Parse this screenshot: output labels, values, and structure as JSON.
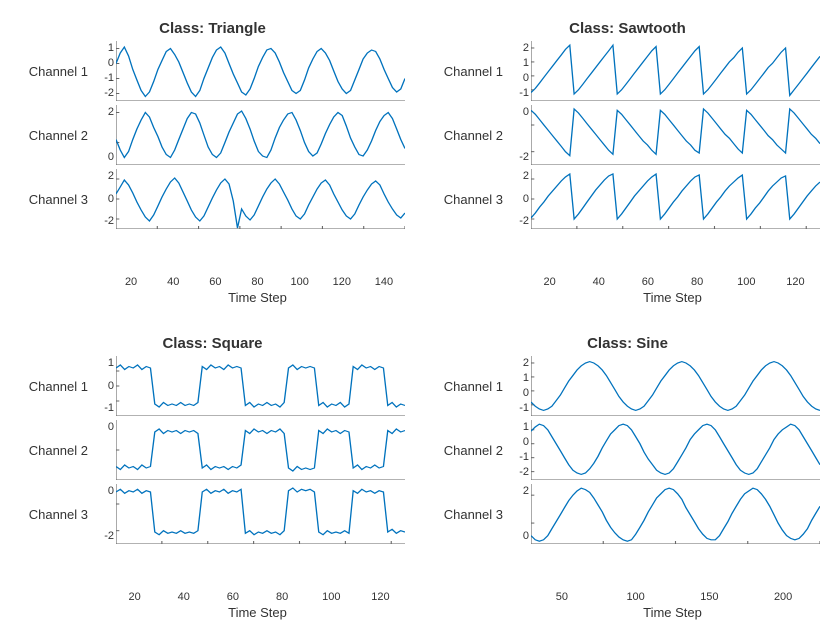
{
  "colors": {
    "line": "#0072BD",
    "axis": "#666"
  },
  "chart_data": [
    {
      "title": "Class: Triangle",
      "xlabel": "Time Step",
      "xlim": [
        0,
        140
      ],
      "xticks": [
        20,
        40,
        60,
        80,
        100,
        120,
        140
      ],
      "channels": [
        {
          "label": "Channel 1",
          "yticks": [
            1,
            0,
            -1,
            -2
          ],
          "ylim": [
            -2.5,
            1.5
          ],
          "values": [
            0.0,
            0.7,
            1.1,
            0.5,
            -0.4,
            -1.1,
            -1.8,
            -2.2,
            -1.9,
            -1.2,
            -0.4,
            0.2,
            0.8,
            1.0,
            0.6,
            0.1,
            -0.6,
            -1.3,
            -1.9,
            -2.2,
            -1.8,
            -1.0,
            -0.3,
            0.4,
            0.9,
            1.1,
            0.7,
            0.0,
            -0.7,
            -1.3,
            -1.9,
            -2.1,
            -1.7,
            -1.0,
            -0.2,
            0.4,
            0.9,
            1.0,
            0.7,
            0.1,
            -0.6,
            -1.2,
            -1.8,
            -2.0,
            -1.8,
            -1.1,
            -0.3,
            0.3,
            0.8,
            1.0,
            0.7,
            0.2,
            -0.5,
            -1.2,
            -1.7,
            -2.0,
            -1.8,
            -1.1,
            -0.4,
            0.3,
            0.7,
            0.9,
            0.8,
            0.3,
            -0.4,
            -1.0,
            -1.6,
            -1.9,
            -1.7,
            -1.0
          ]
        },
        {
          "label": "Channel 2",
          "yticks": [
            2,
            0
          ],
          "ylim": [
            -1.5,
            2.5
          ],
          "values": [
            0.2,
            -0.5,
            -1.0,
            -0.6,
            0.2,
            0.9,
            1.5,
            2.0,
            1.7,
            1.0,
            0.4,
            -0.3,
            -0.8,
            -1.0,
            -0.5,
            0.2,
            0.9,
            1.6,
            2.0,
            1.9,
            1.3,
            0.5,
            -0.3,
            -0.8,
            -1.0,
            -0.7,
            0.0,
            0.7,
            1.3,
            1.9,
            2.1,
            1.6,
            0.9,
            0.1,
            -0.6,
            -0.9,
            -1.0,
            -0.5,
            0.3,
            1.0,
            1.5,
            1.9,
            2.0,
            1.5,
            0.8,
            0.0,
            -0.6,
            -0.9,
            -0.7,
            -0.1,
            0.6,
            1.2,
            1.7,
            2.0,
            1.8,
            1.1,
            0.3,
            -0.3,
            -0.8,
            -0.9,
            -0.5,
            0.1,
            0.8,
            1.4,
            1.8,
            2.0,
            1.6,
            0.9,
            0.2,
            -0.4
          ]
        },
        {
          "label": "Channel 3",
          "yticks": [
            2,
            0,
            -2
          ],
          "ylim": [
            -3,
            3
          ],
          "values": [
            0.5,
            1.2,
            1.9,
            1.4,
            0.6,
            -0.3,
            -1.1,
            -1.8,
            -2.2,
            -1.6,
            -0.7,
            0.2,
            1.0,
            1.7,
            2.1,
            1.6,
            0.7,
            -0.2,
            -1.1,
            -1.8,
            -2.2,
            -1.7,
            -0.8,
            0.1,
            0.9,
            1.6,
            2.0,
            1.5,
            -0.2,
            -2.9,
            -1.0,
            -1.7,
            -2.1,
            -1.6,
            -0.7,
            0.2,
            1.0,
            1.6,
            2.0,
            1.5,
            0.7,
            -0.1,
            -1.0,
            -1.7,
            -2.0,
            -1.5,
            -0.6,
            0.2,
            1.0,
            1.6,
            1.9,
            1.4,
            0.5,
            -0.3,
            -1.1,
            -1.7,
            -2.0,
            -1.5,
            -0.6,
            0.2,
            0.9,
            1.5,
            1.8,
            1.4,
            0.5,
            -0.3,
            -1.0,
            -1.6,
            -1.9,
            -1.4
          ]
        }
      ]
    },
    {
      "title": "Class: Sawtooth",
      "xlabel": "Time Step",
      "xlim": [
        0,
        126
      ],
      "xticks": [
        20,
        40,
        60,
        80,
        100,
        120
      ],
      "channels": [
        {
          "label": "Channel 1",
          "yticks": [
            2,
            1,
            0,
            -1
          ],
          "ylim": [
            -1.8,
            2.5
          ],
          "values": [
            -1.2,
            -0.9,
            -0.5,
            -0.1,
            0.3,
            0.7,
            1.1,
            1.5,
            1.9,
            2.2,
            -1.3,
            -1.0,
            -0.6,
            -0.2,
            0.2,
            0.6,
            1.0,
            1.4,
            1.8,
            2.2,
            -1.3,
            -1.0,
            -0.6,
            -0.2,
            0.2,
            0.6,
            1.0,
            1.4,
            1.8,
            2.1,
            -1.3,
            -1.0,
            -0.6,
            -0.2,
            0.2,
            0.6,
            1.0,
            1.4,
            1.8,
            2.1,
            -1.3,
            -1.0,
            -0.6,
            -0.2,
            0.2,
            0.6,
            1.0,
            1.3,
            1.7,
            2.0,
            -1.3,
            -1.0,
            -0.6,
            -0.2,
            0.2,
            0.6,
            0.9,
            1.3,
            1.7,
            2.0,
            -1.4,
            -1.0,
            -0.6,
            -0.2,
            0.2,
            0.6,
            1.0,
            1.4
          ]
        },
        {
          "label": "Channel 2",
          "yticks": [
            0,
            -2
          ],
          "ylim": [
            -3,
            1.5
          ],
          "values": [
            1.1,
            0.8,
            0.4,
            0.0,
            -0.4,
            -0.8,
            -1.2,
            -1.6,
            -2.0,
            -2.3,
            1.2,
            0.9,
            0.5,
            0.1,
            -0.3,
            -0.7,
            -1.1,
            -1.5,
            -1.9,
            -2.2,
            1.1,
            0.8,
            0.4,
            0.0,
            -0.4,
            -0.8,
            -1.2,
            -1.5,
            -1.9,
            -2.2,
            1.1,
            0.8,
            0.4,
            0.0,
            -0.4,
            -0.8,
            -1.2,
            -1.5,
            -1.9,
            -2.1,
            1.2,
            0.9,
            0.5,
            0.1,
            -0.3,
            -0.7,
            -1.0,
            -1.4,
            -1.8,
            -2.1,
            1.1,
            0.8,
            0.4,
            0.0,
            -0.4,
            -0.8,
            -1.1,
            -1.5,
            -1.8,
            -2.1,
            1.2,
            0.9,
            0.5,
            0.1,
            -0.3,
            -0.7,
            -1.0,
            -1.4
          ]
        },
        {
          "label": "Channel 3",
          "yticks": [
            2,
            0,
            -2
          ],
          "ylim": [
            -3,
            3
          ],
          "values": [
            -1.9,
            -1.4,
            -0.8,
            -0.3,
            0.3,
            0.8,
            1.3,
            1.8,
            2.2,
            2.5,
            -2.0,
            -1.5,
            -0.9,
            -0.3,
            0.3,
            0.9,
            1.4,
            1.9,
            2.3,
            2.5,
            -2.0,
            -1.5,
            -0.9,
            -0.3,
            0.3,
            0.8,
            1.3,
            1.8,
            2.2,
            2.5,
            -2.0,
            -1.5,
            -0.9,
            -0.3,
            0.2,
            0.8,
            1.3,
            1.8,
            2.2,
            2.4,
            -2.0,
            -1.5,
            -0.9,
            -0.3,
            0.2,
            0.8,
            1.3,
            1.7,
            2.1,
            2.4,
            -2.0,
            -1.5,
            -0.9,
            -0.4,
            0.2,
            0.8,
            1.3,
            1.7,
            2.1,
            2.3,
            -2.0,
            -1.5,
            -0.9,
            -0.3,
            0.3,
            0.8,
            1.3,
            1.7
          ]
        }
      ]
    },
    {
      "title": "Class: Square",
      "xlabel": "Time Step",
      "xlim": [
        0,
        126
      ],
      "xticks": [
        20,
        40,
        60,
        80,
        100,
        120
      ],
      "channels": [
        {
          "label": "Channel 1",
          "yticks": [
            1,
            0,
            -1
          ],
          "ylim": [
            -2,
            2
          ],
          "values": [
            1.2,
            1.4,
            1.1,
            1.3,
            1.2,
            1.4,
            1.1,
            1.3,
            1.2,
            -1.2,
            -1.4,
            -1.1,
            -1.3,
            -1.2,
            -1.3,
            -1.1,
            -1.3,
            -1.2,
            -1.3,
            -1.1,
            1.3,
            1.1,
            1.4,
            1.2,
            1.3,
            1.1,
            1.4,
            1.2,
            1.3,
            1.2,
            -1.3,
            -1.1,
            -1.4,
            -1.2,
            -1.3,
            -1.1,
            -1.3,
            -1.2,
            -1.4,
            -1.1,
            1.2,
            1.4,
            1.1,
            1.3,
            1.2,
            1.3,
            1.2,
            -1.3,
            -1.1,
            -1.4,
            -1.2,
            -1.3,
            -1.1,
            -1.4,
            -1.2,
            1.3,
            1.1,
            1.4,
            1.2,
            1.3,
            1.1,
            1.3,
            1.2,
            -1.3,
            -1.1,
            -1.4,
            -1.2,
            -1.3
          ]
        },
        {
          "label": "Channel 2",
          "yticks": [
            0
          ],
          "ylim": [
            -2,
            2
          ],
          "values": [
            -1.1,
            -1.3,
            -1.0,
            -1.2,
            -1.1,
            -1.3,
            -1.0,
            -1.2,
            -1.1,
            1.2,
            1.4,
            1.1,
            1.3,
            1.2,
            1.3,
            1.1,
            1.3,
            1.2,
            1.3,
            1.1,
            -1.2,
            -1.0,
            -1.3,
            -1.1,
            -1.2,
            -1.1,
            -1.3,
            -1.1,
            -1.2,
            -1.0,
            1.3,
            1.1,
            1.4,
            1.2,
            1.3,
            1.1,
            1.3,
            1.2,
            1.4,
            1.1,
            -1.2,
            -1.4,
            -1.1,
            -1.3,
            -1.2,
            -1.3,
            -1.2,
            1.3,
            1.1,
            1.4,
            1.2,
            1.3,
            1.1,
            1.3,
            1.2,
            -1.2,
            -1.0,
            -1.3,
            -1.1,
            -1.2,
            -1.0,
            -1.2,
            -1.1,
            1.3,
            1.1,
            1.4,
            1.2,
            1.3
          ]
        },
        {
          "label": "Channel 3",
          "yticks": [
            0,
            -2
          ],
          "ylim": [
            -3,
            1.5
          ],
          "values": [
            0.9,
            1.1,
            0.8,
            1.0,
            0.9,
            1.1,
            0.8,
            1.0,
            0.9,
            -2.1,
            -2.3,
            -2.0,
            -2.2,
            -2.1,
            -2.2,
            -2.0,
            -2.2,
            -2.1,
            -2.2,
            -2.0,
            0.9,
            1.1,
            0.8,
            1.0,
            0.9,
            1.1,
            0.8,
            1.0,
            0.9,
            1.1,
            -2.2,
            -2.0,
            -2.3,
            -2.1,
            -2.2,
            -2.0,
            -2.2,
            -2.1,
            -2.3,
            -2.0,
            1.0,
            1.2,
            0.9,
            1.1,
            1.0,
            1.1,
            0.9,
            -2.1,
            -2.3,
            -2.0,
            -2.2,
            -2.1,
            -2.2,
            -2.0,
            -2.2,
            1.0,
            0.8,
            1.1,
            0.9,
            1.0,
            0.8,
            1.0,
            0.9,
            -2.1,
            -1.9,
            -2.2,
            -2.0,
            -2.1
          ]
        }
      ]
    },
    {
      "title": "Class: Sine",
      "xlabel": "Time Step",
      "xlim": [
        0,
        200
      ],
      "xticks": [
        50,
        100,
        150,
        200
      ],
      "channels": [
        {
          "label": "Channel 1",
          "yticks": [
            2,
            1,
            0,
            -1
          ],
          "ylim": [
            -1.8,
            2.5
          ],
          "values": [
            -0.8,
            -1.1,
            -1.3,
            -1.4,
            -1.3,
            -1.1,
            -0.7,
            -0.3,
            0.2,
            0.7,
            1.1,
            1.5,
            1.8,
            2.0,
            2.1,
            2.0,
            1.8,
            1.5,
            1.1,
            0.6,
            0.1,
            -0.4,
            -0.8,
            -1.1,
            -1.3,
            -1.4,
            -1.3,
            -1.1,
            -0.7,
            -0.3,
            0.2,
            0.7,
            1.1,
            1.5,
            1.8,
            2.0,
            2.1,
            2.0,
            1.8,
            1.5,
            1.1,
            0.6,
            0.1,
            -0.4,
            -0.8,
            -1.1,
            -1.3,
            -1.4,
            -1.3,
            -1.1,
            -0.7,
            -0.3,
            0.2,
            0.7,
            1.1,
            1.5,
            1.8,
            2.0,
            2.1,
            2.0,
            1.8,
            1.5,
            1.1,
            0.6,
            0.1,
            -0.4,
            -0.8,
            -1.1,
            -1.3,
            -1.4
          ]
        },
        {
          "label": "Channel 2",
          "yticks": [
            1,
            0,
            -1,
            -2
          ],
          "ylim": [
            -2.6,
            1.7
          ],
          "values": [
            0.9,
            1.2,
            1.4,
            1.3,
            1.0,
            0.5,
            0.0,
            -0.5,
            -1.0,
            -1.5,
            -1.9,
            -2.1,
            -2.2,
            -2.1,
            -1.8,
            -1.4,
            -0.9,
            -0.3,
            0.2,
            0.7,
            1.0,
            1.3,
            1.4,
            1.3,
            1.0,
            0.5,
            0.0,
            -0.6,
            -1.1,
            -1.5,
            -1.9,
            -2.1,
            -2.2,
            -2.1,
            -1.8,
            -1.3,
            -0.8,
            -0.3,
            0.3,
            0.7,
            1.0,
            1.3,
            1.4,
            1.3,
            1.0,
            0.5,
            0.0,
            -0.5,
            -1.0,
            -1.5,
            -1.9,
            -2.1,
            -2.2,
            -2.1,
            -1.8,
            -1.3,
            -0.8,
            -0.3,
            0.3,
            0.7,
            1.0,
            1.2,
            1.4,
            1.3,
            1.0,
            0.5,
            0.0,
            -0.5,
            -1.0,
            -1.5
          ]
        },
        {
          "label": "Channel 3",
          "yticks": [
            2,
            0
          ],
          "ylim": [
            -1.5,
            2.8
          ],
          "values": [
            -0.9,
            -1.2,
            -1.3,
            -1.2,
            -0.9,
            -0.4,
            0.1,
            0.6,
            1.1,
            1.6,
            2.0,
            2.3,
            2.5,
            2.4,
            2.2,
            1.8,
            1.3,
            0.8,
            0.2,
            -0.3,
            -0.7,
            -1.0,
            -1.2,
            -1.3,
            -1.2,
            -0.8,
            -0.3,
            0.2,
            0.8,
            1.3,
            1.8,
            2.1,
            2.4,
            2.5,
            2.4,
            2.1,
            1.7,
            1.1,
            0.6,
            0.1,
            -0.4,
            -0.8,
            -1.1,
            -1.2,
            -1.2,
            -0.9,
            -0.4,
            0.1,
            0.7,
            1.2,
            1.7,
            2.1,
            2.3,
            2.5,
            2.4,
            2.1,
            1.7,
            1.2,
            0.6,
            0.0,
            -0.5,
            -0.9,
            -1.1,
            -1.2,
            -1.1,
            -0.8,
            -0.4,
            0.2,
            0.7,
            1.2
          ]
        }
      ]
    }
  ]
}
